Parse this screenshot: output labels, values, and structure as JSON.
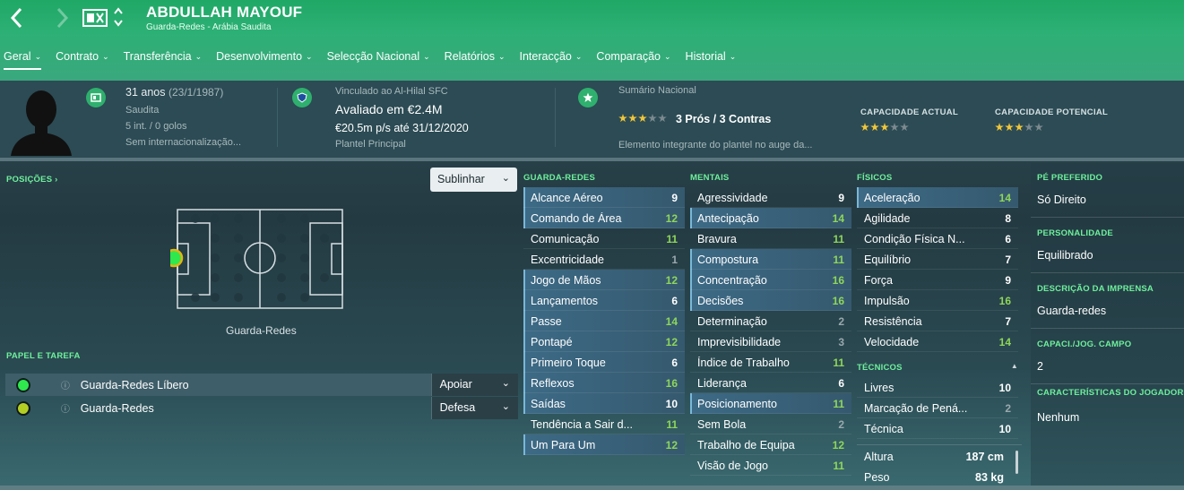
{
  "header": {
    "player_name": "ABDULLAH MAYOUF",
    "subtitle": "Guarda-Redes - Arábia Saudita"
  },
  "tabs": [
    {
      "label": "Geral"
    },
    {
      "label": "Contrato"
    },
    {
      "label": "Transferência"
    },
    {
      "label": "Desenvolvimento"
    },
    {
      "label": "Selecção Nacional"
    },
    {
      "label": "Relatórios"
    },
    {
      "label": "Interacção"
    },
    {
      "label": "Comparação"
    },
    {
      "label": "Historial"
    }
  ],
  "info": {
    "age": "31 anos",
    "dob": "(23/1/1987)",
    "nationality": "Saudita",
    "caps": "5 int. / 0 golos",
    "international": "Sem internacionalização...",
    "club_line": "Vinculado ao Al-Hilal SFC",
    "value": "Avaliado em €2.4M",
    "wage": "€20.5m p/s até 31/12/2020",
    "squad": "Plantel Principal",
    "summary_title": "Sumário Nacional",
    "summary_rating": "3 Prós / 3 Contras",
    "summary_text": "Elemento integrante do plantel no auge da...",
    "current_ability_label": "CAPACIDADE ACTUAL",
    "potential_ability_label": "CAPACIDADE POTENCIAL",
    "summary_stars": 3,
    "current_ability_stars": 3,
    "potential_ability_stars": 3
  },
  "positions": {
    "header": "POSIÇÕES",
    "highlight_dropdown": "Sublinhar",
    "position_label": "Guarda-Redes"
  },
  "roles": {
    "header": "PAPEL E TAREFA",
    "items": [
      {
        "name": "Guarda-Redes Líbero",
        "duty": "Apoiar",
        "color": "#2ee84e"
      },
      {
        "name": "Guarda-Redes",
        "duty": "Defesa",
        "color": "#b4cf23"
      }
    ]
  },
  "goalkeeping": {
    "header": "GUARDA-REDES",
    "items": [
      {
        "name": "Alcance Aéreo",
        "value": "9"
      },
      {
        "name": "Comando de Área",
        "value": "12"
      },
      {
        "name": "Comunicação",
        "value": "11"
      },
      {
        "name": "Excentricidade",
        "value": "1"
      },
      {
        "name": "Jogo de Mãos",
        "value": "12"
      },
      {
        "name": "Lançamentos",
        "value": "6"
      },
      {
        "name": "Passe",
        "value": "14"
      },
      {
        "name": "Pontapé",
        "value": "12"
      },
      {
        "name": "Primeiro Toque",
        "value": "6"
      },
      {
        "name": "Reflexos",
        "value": "16"
      },
      {
        "name": "Saídas",
        "value": "10"
      },
      {
        "name": "Tendência a Sair d...",
        "value": "11"
      },
      {
        "name": "Um Para Um",
        "value": "12"
      }
    ]
  },
  "mental": {
    "header": "MENTAIS",
    "items": [
      {
        "name": "Agressividade",
        "value": "9"
      },
      {
        "name": "Antecipação",
        "value": "14"
      },
      {
        "name": "Bravura",
        "value": "11"
      },
      {
        "name": "Compostura",
        "value": "11"
      },
      {
        "name": "Concentração",
        "value": "16"
      },
      {
        "name": "Decisões",
        "value": "16"
      },
      {
        "name": "Determinação",
        "value": "2"
      },
      {
        "name": "Imprevisibilidade",
        "value": "3"
      },
      {
        "name": "Índice de Trabalho",
        "value": "11"
      },
      {
        "name": "Liderança",
        "value": "6"
      },
      {
        "name": "Posicionamento",
        "value": "11"
      },
      {
        "name": "Sem Bola",
        "value": "2"
      },
      {
        "name": "Trabalho de Equipa",
        "value": "12"
      },
      {
        "name": "Visão de Jogo",
        "value": "11"
      }
    ]
  },
  "physical": {
    "header": "FÍSICOS",
    "items": [
      {
        "name": "Aceleração",
        "value": "14"
      },
      {
        "name": "Agilidade",
        "value": "8"
      },
      {
        "name": "Condição Física N...",
        "value": "6"
      },
      {
        "name": "Equilíbrio",
        "value": "7"
      },
      {
        "name": "Força",
        "value": "9"
      },
      {
        "name": "Impulsão",
        "value": "16"
      },
      {
        "name": "Resistência",
        "value": "7"
      },
      {
        "name": "Velocidade",
        "value": "14"
      }
    ]
  },
  "technical": {
    "header": "TÉCNICOS",
    "items": [
      {
        "name": "Livres",
        "value": "10"
      },
      {
        "name": "Marcação de Pená...",
        "value": "2"
      },
      {
        "name": "Técnica",
        "value": "10"
      }
    ]
  },
  "body": {
    "height_label": "Altura",
    "height": "187 cm",
    "weight_label": "Peso",
    "weight": "83 kg"
  },
  "right_panel": {
    "foot_label": "PÉ PREFERIDO",
    "foot": "Só Direito",
    "personality_label": "PERSONALIDADE",
    "personality": "Equilibrado",
    "press_label": "DESCRIÇÃO DA IMPRENSA",
    "press": "Guarda-redes",
    "outfield_label": "CAPACI./JOG. CAMPO",
    "outfield": "2",
    "traits_label": "CARACTERÍSTICAS DO JOGADOR",
    "traits": "Nenhum"
  }
}
